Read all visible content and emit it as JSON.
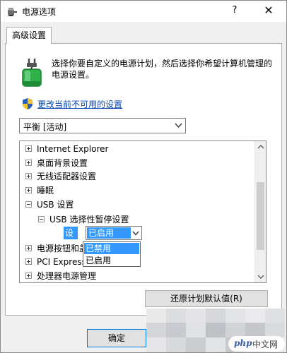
{
  "window": {
    "title": "电源选项",
    "help_glyph": "?",
    "close_glyph": "✕"
  },
  "tab": {
    "label": "高级设置"
  },
  "description": "选择你要自定义的电源计划，然后选择你希望计算机管理的电源设置。",
  "change_link": "更改当前不可用的设置",
  "plan_select": {
    "value": "平衡 [活动]"
  },
  "tree": {
    "items": [
      {
        "label": "Internet Explorer"
      },
      {
        "label": "桌面背景设置"
      },
      {
        "label": "无线适配器设置"
      },
      {
        "label": "睡眠"
      },
      {
        "label": "USB 设置"
      },
      {
        "label": "USB 选择性暂停设置"
      },
      {
        "label": "电源按钮和盖"
      },
      {
        "label": "PCI Express"
      },
      {
        "label": "处理器电源管理"
      }
    ],
    "setting": {
      "label": "设置:",
      "selected": "已启用"
    }
  },
  "dropdown": {
    "options": [
      "已禁用",
      "已启用"
    ],
    "highlighted_index": 0
  },
  "buttons": {
    "restore": "还原计划默认值(R)",
    "ok": "确定"
  },
  "watermark": {
    "brand": "php",
    "text": "中文网"
  },
  "colors": {
    "accent": "#3399ff",
    "link": "#0645ad",
    "battery_green": "#2fb24a"
  }
}
